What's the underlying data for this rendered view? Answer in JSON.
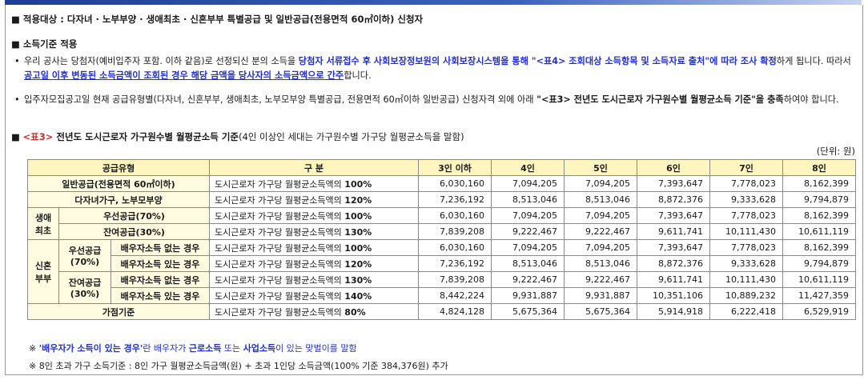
{
  "target": {
    "bullet": "■",
    "text": "적용대상 : 다자녀 · 노부부양 · 생애최초 · 신혼부부 특별공급 및 일반공급(전용면적 60㎡이하) 신청자"
  },
  "income_section": {
    "bullet": "■",
    "title": "소득기준 적용",
    "p1": {
      "a": "우리 공사는 당첨자(예비입주자 포함. 이하 같음)로 선정되신 분의 소득을 ",
      "b": "당첨자 서류접수 후 사회보장정보원의 사회보장시스템을 통해  \"<표4> 조회대상 소득항목 및 소득자료 출처\"에 따라 조사 확정",
      "c": "하게 됩니다. 따라서 ",
      "d": "공고일 이후 변동된 소득금액이 조회된 경우 해당 금액을 당사자의 소득금액으로 간주",
      "e": "합니다."
    },
    "p2": {
      "a": "입주자모집공고일 현재 공급유형별(다자녀, 신혼부부, 생애최초, 노부모부양 특별공급, 전용면적 60㎡이하 일반공급) 신청자격 외에 아래 ",
      "b": "\"<표3> 전년도 도시근로자 가구원수별 월평균소득 기준\"을 충족",
      "c": "하여야 합니다."
    }
  },
  "table_section": {
    "bullet": "■",
    "tag": "<표3>",
    "title": " 전년도 도시근로자 가구원수별 월평균소득 기준",
    "sub": "(4인 이상인 세대는 가구원수별 가구당 월평균소득을 말함)",
    "unit": "(단위: 원)"
  },
  "table": {
    "headers": [
      "공급유형",
      "구  분",
      "3인 이하",
      "4인",
      "5인",
      "6인",
      "7인",
      "8인"
    ],
    "std_prefix": "도시근로자 가구당 월평균소득액의 ",
    "std_prefix_last": "도시근로자 가구당 월평균소득액의  ",
    "group_saengae": "생애\n최초",
    "group_sinhon": "신혼\n부부",
    "sub_woosun": "우선공급\n(70%)",
    "sub_jayeon": "잔여공급\n(30%)",
    "rows": [
      {
        "label": "일반공급(전용면적 60㎡이하)",
        "pct": "100%",
        "values": [
          "6,030,160",
          "7,094,205",
          "7,094,205",
          "7,393,647",
          "7,778,023",
          "8,162,399"
        ]
      },
      {
        "label": "다자녀가구, 노부모부양",
        "pct": "120%",
        "values": [
          "7,236,192",
          "8,513,046",
          "8,513,046",
          "8,872,376",
          "9,333,628",
          "9,794,879"
        ]
      },
      {
        "label": "우선공급(70%)",
        "pct": "100%",
        "values": [
          "6,030,160",
          "7,094,205",
          "7,094,205",
          "7,393,647",
          "7,778,023",
          "8,162,399"
        ]
      },
      {
        "label": "잔여공급(30%)",
        "pct": "130%",
        "values": [
          "7,839,208",
          "9,222,467",
          "9,222,467",
          "9,611,741",
          "10,111,430",
          "10,611,119"
        ]
      },
      {
        "label": "배우자소득 없는 경우",
        "pct": "100%",
        "values": [
          "6,030,160",
          "7,094,205",
          "7,094,205",
          "7,393,647",
          "7,778,023",
          "8,162,399"
        ]
      },
      {
        "label": "배우자소득 있는 경우",
        "pct": "120%",
        "values": [
          "7,236,192",
          "8,513,046",
          "8,513,046",
          "8,872,376",
          "9,333,628",
          "9,794,879"
        ]
      },
      {
        "label": "배우자소득 없는 경우",
        "pct": "130%",
        "values": [
          "7,839,208",
          "9,222,467",
          "9,222,467",
          "9,611,741",
          "10,111,430",
          "10,611,119"
        ]
      },
      {
        "label": "배우자소득 있는 경우",
        "pct": "140%",
        "values": [
          "8,442,224",
          "9,931,887",
          "9,931,887",
          "10,351,106",
          "10,889,232",
          "11,427,359"
        ]
      },
      {
        "label": "가점기준",
        "pct": "80%",
        "values": [
          "4,824,128",
          "5,675,364",
          "5,675,364",
          "5,914,918",
          "6,222,418",
          "6,529,919"
        ]
      }
    ]
  },
  "notes": {
    "n1_mark": "※",
    "n1_a": "'배우자가 소득이 있는 경우'",
    "n1_b": "란 배우자가 ",
    "n1_c": "근로소득",
    "n1_d": " 또는 ",
    "n1_e": "사업소득",
    "n1_f": "이 있는 맞벌이를 말함",
    "n2_mark": "※",
    "n2": "8인 초과 가구 소득기준 : 8인 가구 월평균소득금액(원) + 초과 1인당 소득금액(100% 기준 384,376원) 추가"
  }
}
